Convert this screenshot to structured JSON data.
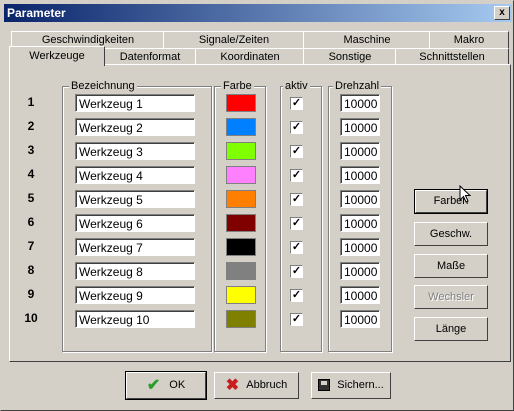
{
  "window": {
    "title": "Parameter",
    "close_label": "x"
  },
  "tabs_back": [
    "Geschwindigkeiten",
    "Signale/Zeiten",
    "Maschine",
    "Makro"
  ],
  "tabs_front": [
    "Werkzeuge",
    "Datenformat",
    "Koordinaten",
    "Sonstige",
    "Schnittstellen"
  ],
  "groups": {
    "name": "Bezeichnung",
    "color": "Farbe",
    "active": "aktiv",
    "speed": "Drehzahl"
  },
  "tools": [
    {
      "num": "1",
      "name": "Werkzeug 1",
      "color": "#ff0000",
      "active": true,
      "speed": "10000"
    },
    {
      "num": "2",
      "name": "Werkzeug 2",
      "color": "#0080ff",
      "active": true,
      "speed": "10000"
    },
    {
      "num": "3",
      "name": "Werkzeug 3",
      "color": "#80ff00",
      "active": true,
      "speed": "10000"
    },
    {
      "num": "4",
      "name": "Werkzeug 4",
      "color": "#ff80ff",
      "active": true,
      "speed": "10000"
    },
    {
      "num": "5",
      "name": "Werkzeug 5",
      "color": "#ff8000",
      "active": true,
      "speed": "10000"
    },
    {
      "num": "6",
      "name": "Werkzeug 6",
      "color": "#800000",
      "active": true,
      "speed": "10000"
    },
    {
      "num": "7",
      "name": "Werkzeug 7",
      "color": "#000000",
      "active": true,
      "speed": "10000"
    },
    {
      "num": "8",
      "name": "Werkzeug 8",
      "color": "#808080",
      "active": true,
      "speed": "10000"
    },
    {
      "num": "9",
      "name": "Werkzeug 9",
      "color": "#ffff00",
      "active": true,
      "speed": "10000"
    },
    {
      "num": "10",
      "name": "Werkzeug 10",
      "color": "#808000",
      "active": true,
      "speed": "10000"
    }
  ],
  "side_buttons": {
    "colors": "Farben",
    "speed": "Geschw.",
    "size": "Maße",
    "changer": "Wechsler",
    "length": "Länge"
  },
  "bottom_buttons": {
    "ok": "OK",
    "cancel": "Abbruch",
    "save": "Sichern..."
  },
  "colors": {
    "titlebar_start": "#0a246a",
    "titlebar_end": "#a6caf0",
    "ok_icon": "#2a9d2a",
    "cancel_icon": "#c81e1e"
  }
}
